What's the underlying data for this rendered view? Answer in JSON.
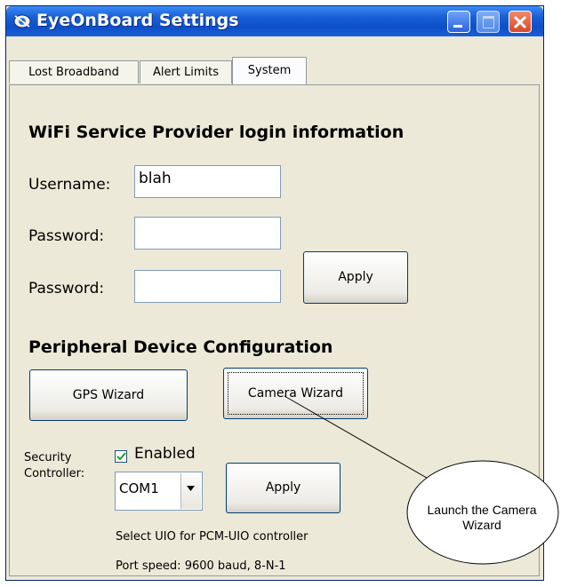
{
  "window": {
    "title": "EyeOnBoard Settings"
  },
  "tabs": [
    {
      "label": "Lost Broadband"
    },
    {
      "label": "Alert Limits"
    },
    {
      "label": "System",
      "active": true
    }
  ],
  "wifi": {
    "heading": "WiFi Service Provider login information",
    "username_label": "Username:",
    "username_value": "blah",
    "password_label": "Password:",
    "password2_label": "Password:",
    "password_value": "",
    "password2_value": "",
    "apply_label": "Apply"
  },
  "peripheral": {
    "heading": "Peripheral Device Configuration",
    "gps_button": "GPS Wizard",
    "camera_button": "Camera Wizard"
  },
  "security": {
    "label_line1": "Security",
    "label_line2": "Controller:",
    "enabled_label": "Enabled",
    "enabled": true,
    "port_value": "COM1",
    "apply_label": "Apply",
    "hint": "Select UIO for PCM-UIO controller",
    "port_speed": "Port speed: 9600 baud, 8-N-1"
  },
  "callout": {
    "line1": "Launch the Camera",
    "line2": "Wizard"
  },
  "icons": {
    "app": "eye-icon",
    "minimize": "minimize-icon",
    "maximize": "maximize-icon",
    "close": "close-icon",
    "dropdown": "chevron-down-icon",
    "check": "check-icon"
  },
  "colors": {
    "titlebar": "#0d4fc8",
    "dialog_bg": "#ece9d8",
    "close_button": "#d8482a"
  }
}
